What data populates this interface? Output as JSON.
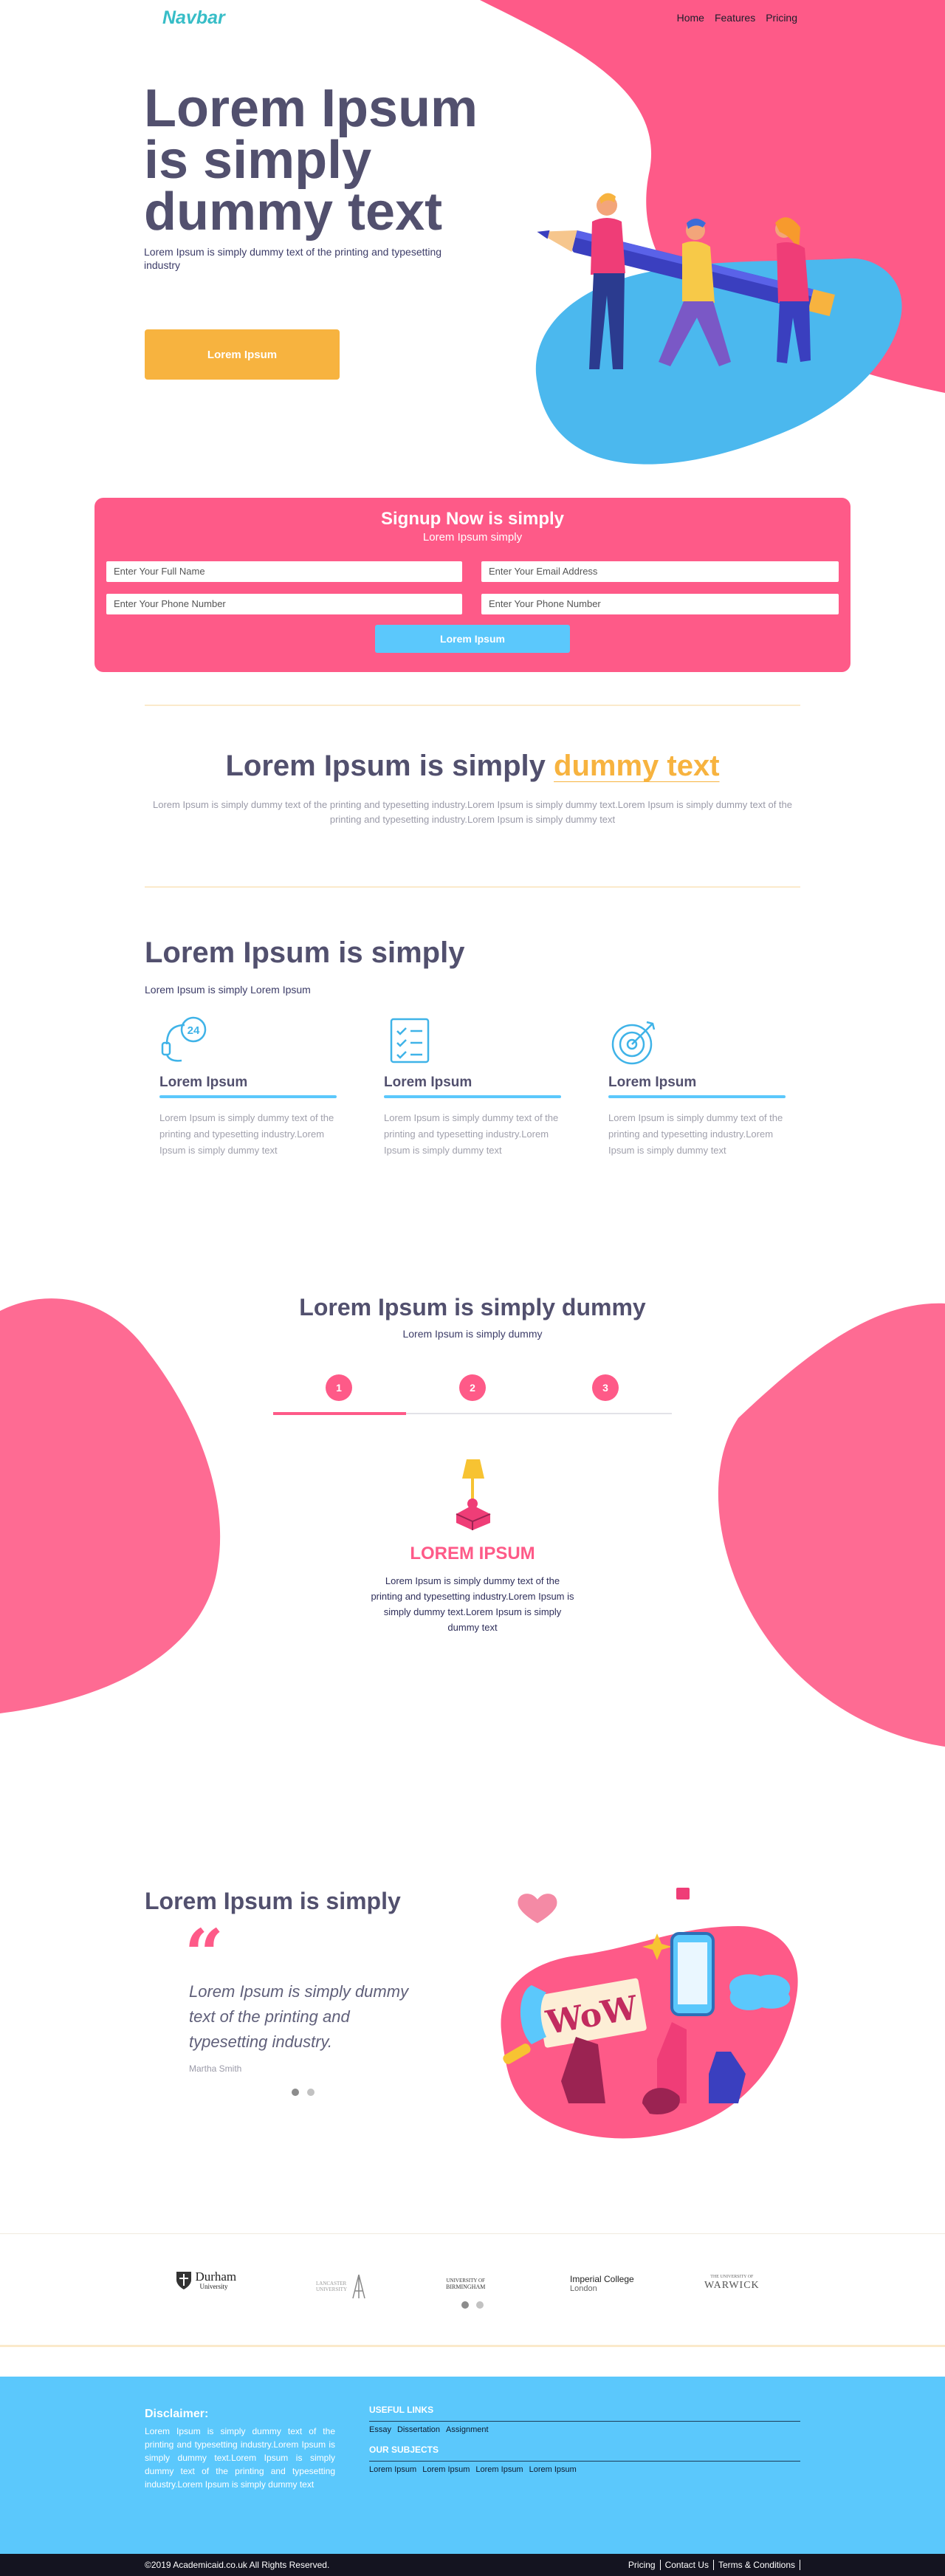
{
  "nav": {
    "brand": "Navbar",
    "links": [
      "Home",
      "Features",
      "Pricing"
    ]
  },
  "hero": {
    "title": "Lorem Ipsum is simply dummy text",
    "subtitle": "Lorem Ipsum is simply dummy text of the printing and typesetting industry",
    "button": "Lorem Ipsum"
  },
  "signup": {
    "title": "Signup Now is simply",
    "subtitle": "Lorem Ipsum simply",
    "fields": {
      "full_name": "Enter Your Full Name",
      "email": "Enter Your Email Address",
      "phone_1": "Enter Your Phone Number",
      "phone_2": "Enter Your Phone Number"
    },
    "button": "Lorem Ipsum"
  },
  "intro": {
    "title_main": "Lorem Ipsum is simply ",
    "title_accent": "dummy text",
    "description": "Lorem Ipsum is simply dummy text of the printing and typesetting industry.Lorem Ipsum is simply dummy text.Lorem Ipsum is simply dummy text of the printing and typesetting industry.Lorem Ipsum is simply dummy text"
  },
  "features": {
    "title": "Lorem Ipsum is simply",
    "subtitle": "Lorem Ipsum is simply Lorem Ipsum",
    "items": [
      {
        "icon": "support-24-icon",
        "name": "Lorem Ipsum",
        "text": "Lorem Ipsum is simply dummy text of the printing and typesetting industry.Lorem Ipsum is simply dummy text"
      },
      {
        "icon": "checklist-icon",
        "name": "Lorem Ipsum",
        "text": "Lorem Ipsum is simply dummy text of the printing and typesetting industry.Lorem Ipsum is simply dummy text"
      },
      {
        "icon": "target-icon",
        "name": "Lorem Ipsum",
        "text": "Lorem Ipsum is simply dummy text of the printing and typesetting industry.Lorem Ipsum is simply dummy text"
      }
    ]
  },
  "steps": {
    "title": "Lorem Ipsum is simply dummy",
    "subtitle": "Lorem Ipsum is simply dummy",
    "labels": [
      "1",
      "2",
      "3"
    ],
    "active_index": 0,
    "item_title": "LOREM IPSUM",
    "item_text": "Lorem Ipsum is simply dummy text of the printing and typesetting industry.Lorem Ipsum is simply dummy text.Lorem Ipsum is simply dummy text"
  },
  "testimonial": {
    "title": "Lorem Ipsum is simply",
    "quote": "Lorem Ipsum is simply dummy text of the printing and typesetting industry.",
    "author": "Martha Smith"
  },
  "logos": [
    {
      "line1": "Durham",
      "line2": "University"
    },
    {
      "line1": "LANCASTER",
      "line2": "UNIVERSITY"
    },
    {
      "line1": "UNIVERSITY OF",
      "line2": "BIRMINGHAM"
    },
    {
      "line1": "Imperial College",
      "line2": "London"
    },
    {
      "line1": "THE UNIVERSITY OF",
      "line2": "WARWICK"
    }
  ],
  "footer": {
    "disclaimer_title": "Disclaimer:",
    "disclaimer_text": "Lorem Ipsum is simply dummy text of the printing and typesetting industry.Lorem Ipsum is simply dummy text.Lorem Ipsum is simply dummy text of the printing and typesetting industry.Lorem Ipsum is simply dummy text",
    "useful_links_title": "USEFUL LINKS",
    "useful_links": [
      "Essay",
      "Dissertation",
      "Assignment"
    ],
    "subjects_title": "OUR SUBJECTS",
    "subjects": [
      "Lorem Ipsum",
      "Lorem Ipsum",
      "Lorem Ipsum",
      "Lorem Ipsum"
    ],
    "copyright": "©2019 Academicaid.co.uk All Rights Reserved.",
    "bottom_links": [
      "Pricing",
      "Contact Us",
      "Terms & Conditions"
    ]
  },
  "colors": {
    "pink": "#fe5a88",
    "blue": "#5bc8fc",
    "yellow": "#f7b33f",
    "heading": "#52506e"
  }
}
